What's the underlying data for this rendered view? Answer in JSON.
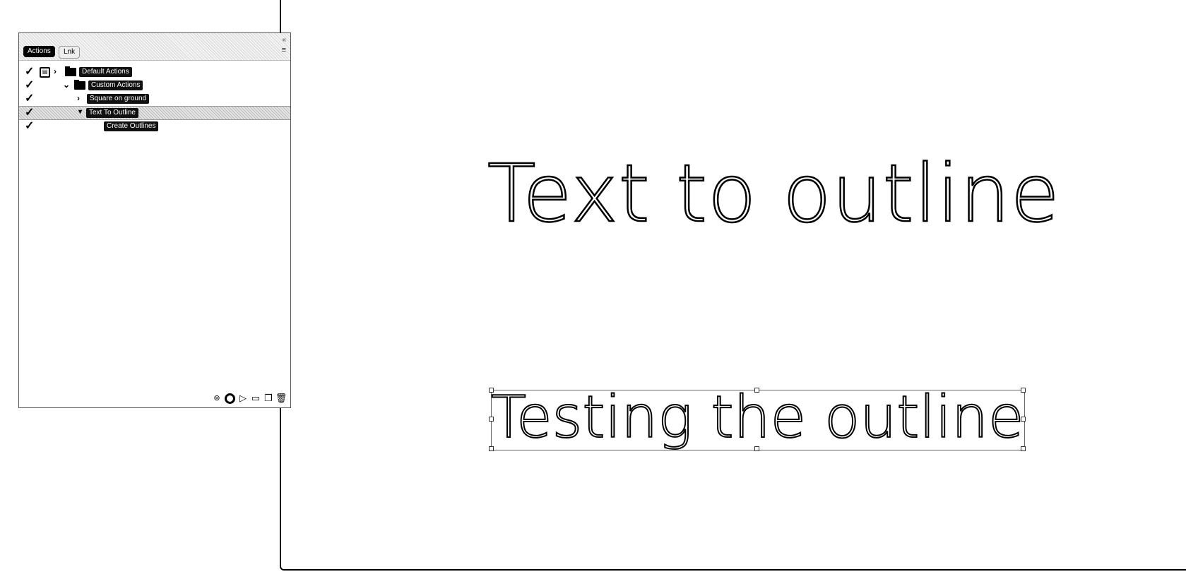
{
  "panel": {
    "tabs": [
      {
        "label": "Actions",
        "active": true
      },
      {
        "label": "Lnk",
        "active": false
      }
    ],
    "items": [
      {
        "label": "Default Actions",
        "checked": true
      },
      {
        "label": "Custom Actions",
        "checked": true
      },
      {
        "label": "Square on ground",
        "checked": true
      },
      {
        "label": "Text To Outline",
        "checked": true,
        "selected": true
      },
      {
        "label": "Create Outlines",
        "checked": true
      }
    ],
    "footer_icons": [
      "new-layer-icon",
      "stop-icon",
      "play-icon",
      "new-set-icon",
      "new-action-icon",
      "trash-icon"
    ]
  },
  "canvas": {
    "headline": "Text to outline",
    "selected_text": "Testing the outline"
  }
}
